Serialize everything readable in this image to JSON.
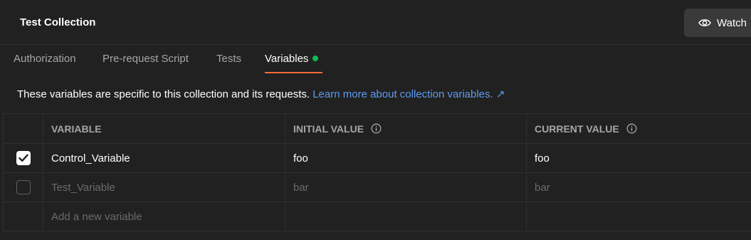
{
  "header": {
    "title": "Test Collection",
    "watch_label": "Watch"
  },
  "tabs": [
    {
      "label": "Authorization"
    },
    {
      "label": "Pre-request Script"
    },
    {
      "label": "Tests"
    },
    {
      "label": "Variables"
    }
  ],
  "info": {
    "text": "These variables are specific to this collection and its requests.",
    "link": "Learn more about collection variables. ↗"
  },
  "table": {
    "headers": {
      "variable": "VARIABLE",
      "initial": "INITIAL VALUE",
      "current": "CURRENT VALUE"
    },
    "rows": [
      {
        "checked": true,
        "name": "Control_Variable",
        "initial": "foo",
        "current": "foo"
      },
      {
        "checked": false,
        "name": "Test_Variable",
        "initial": "bar",
        "current": "bar"
      }
    ],
    "new_placeholder": "Add a new variable"
  },
  "colors": {
    "accent": "#ff6c37",
    "dot": "#0cbb52",
    "link": "#5c9bf0"
  }
}
